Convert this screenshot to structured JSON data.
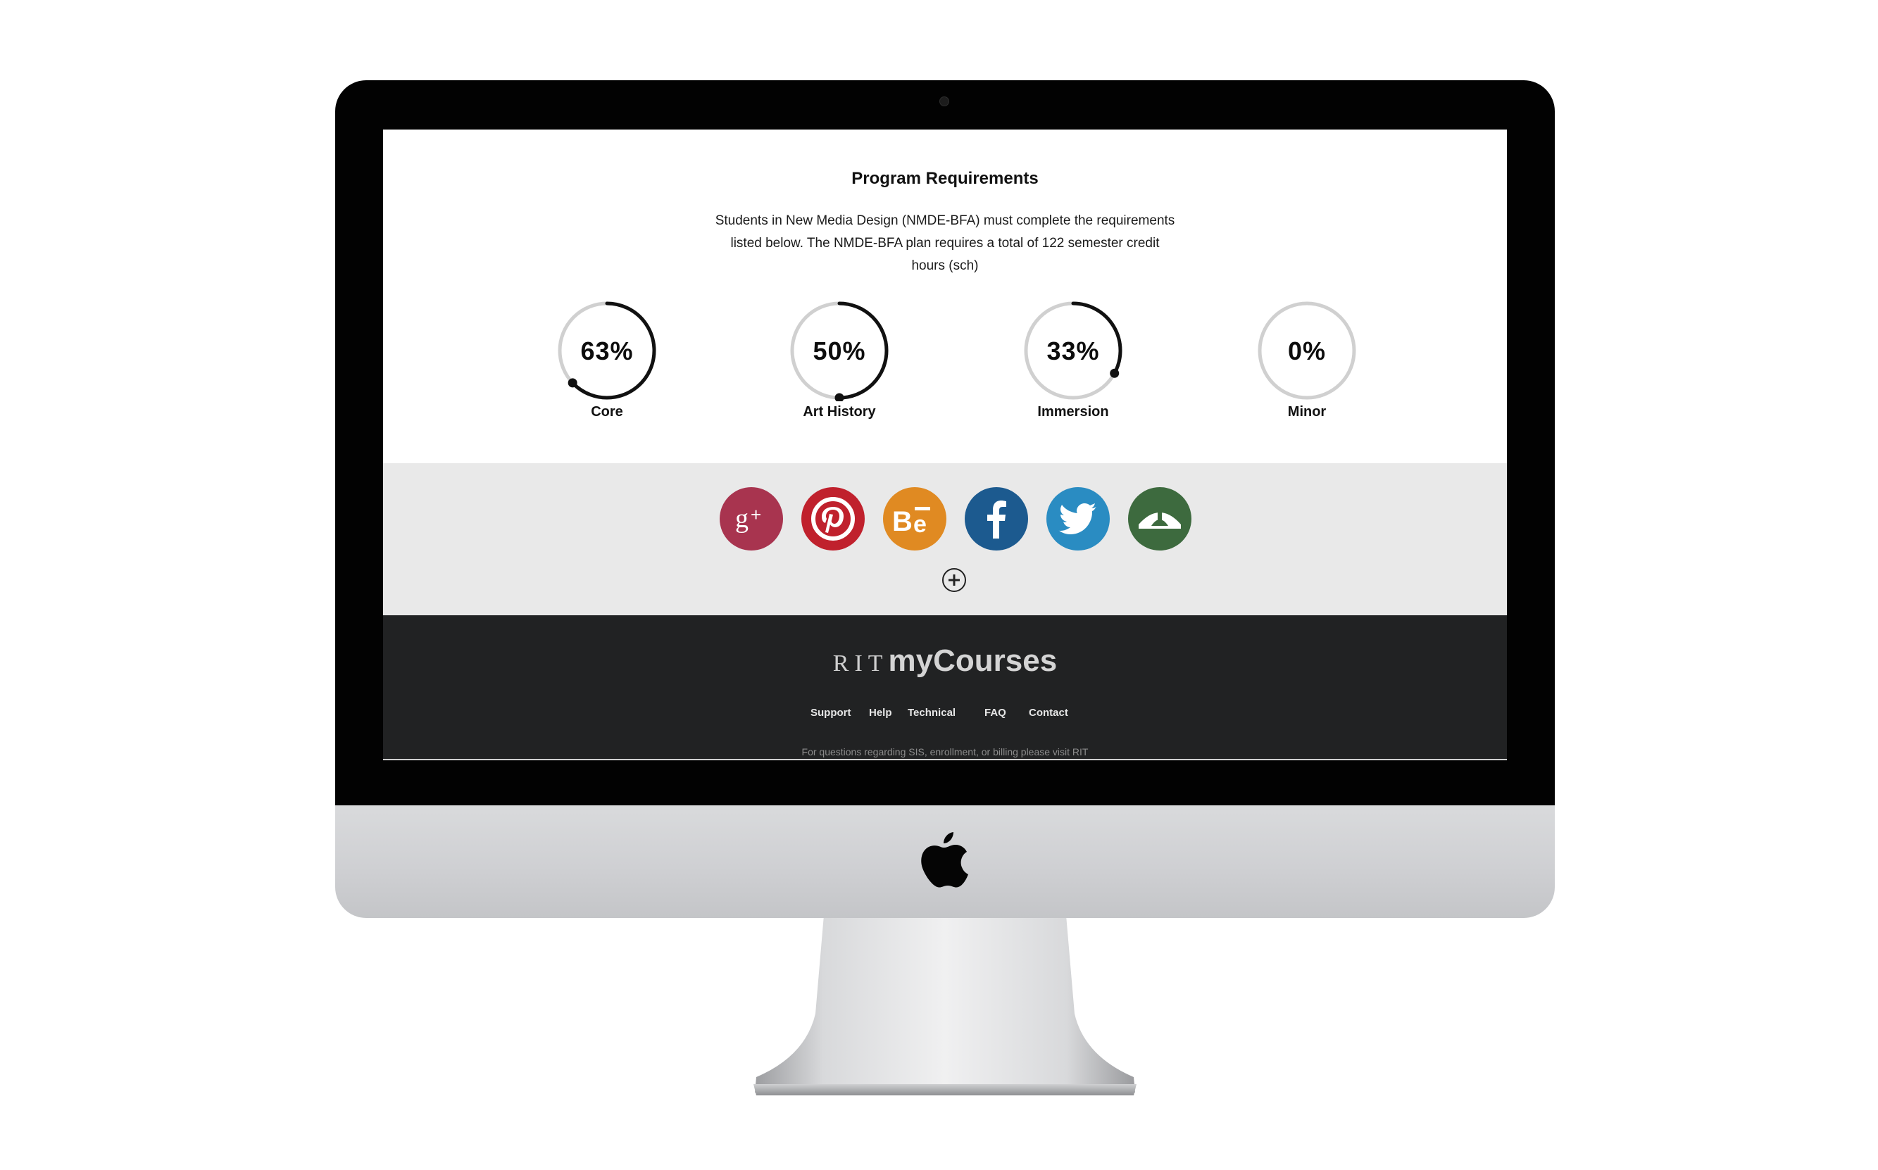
{
  "requirements": {
    "title": "Program Requirements",
    "description": "Students in New Media Design (NMDE-BFA) must complete the requirements listed below. The NMDE-BFA plan requires a total of 122 semester credit hours (sch)",
    "items": [
      {
        "label": "Core",
        "percent_text": "63%",
        "value": 0.63
      },
      {
        "label": "Art History",
        "percent_text": "50%",
        "value": 0.5
      },
      {
        "label": "Immersion",
        "percent_text": "33%",
        "value": 0.33
      },
      {
        "label": "Minor",
        "percent_text": "0%",
        "value": 0.0
      }
    ]
  },
  "social": [
    {
      "name": "google-plus",
      "color": "#a8344f"
    },
    {
      "name": "pinterest",
      "color": "#c0212d"
    },
    {
      "name": "behance",
      "color": "#e08a22"
    },
    {
      "name": "facebook",
      "color": "#1c5a8f"
    },
    {
      "name": "twitter",
      "color": "#2a8cc2"
    },
    {
      "name": "deviantart",
      "color": "#3d6a3e"
    }
  ],
  "footer": {
    "brand_prefix": "RIT",
    "brand_name": "myCourses",
    "links": [
      "Support",
      "Help",
      "Technical",
      "FAQ",
      "Contact"
    ],
    "note": "For questions regarding SIS, enrollment, or billing please visit RIT"
  },
  "colors": {
    "progress_track": "#d0d0d0",
    "progress_fill": "#111111",
    "footer_bg": "#212223",
    "social_bg": "#e9e9e9"
  }
}
